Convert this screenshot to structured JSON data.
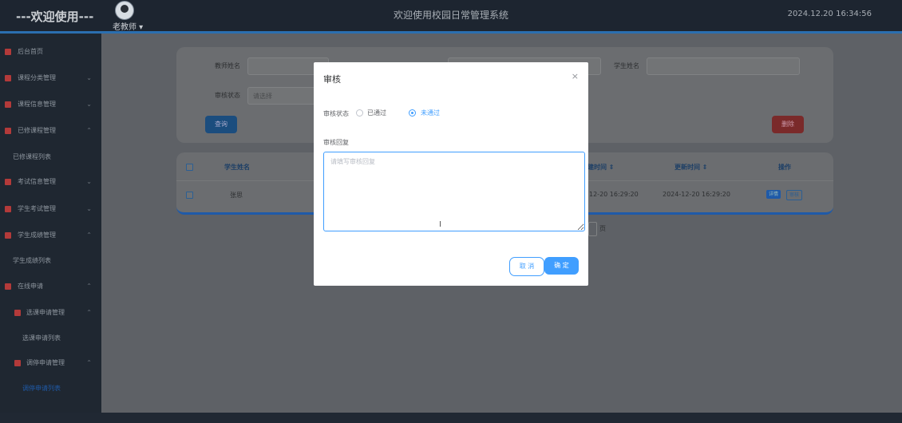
{
  "header": {
    "brand": "---欢迎使用---",
    "user": "老教师 ▾",
    "system_title": "欢迎使用校园日常管理系统",
    "datetime": "2024.12.20 16:34:56"
  },
  "sidebar": {
    "items": [
      {
        "label": "后台首页",
        "arrow": ""
      },
      {
        "label": "课程分类管理",
        "arrow": "⌄"
      },
      {
        "label": "课程信息管理",
        "arrow": "⌄"
      },
      {
        "label": "已修课程管理",
        "arrow": "⌃"
      },
      {
        "label": "已修课程列表",
        "arrow": ""
      },
      {
        "label": "考试信息管理",
        "arrow": "⌄"
      },
      {
        "label": "学生考试管理",
        "arrow": "⌄"
      },
      {
        "label": "学生成绩管理",
        "arrow": "⌃"
      },
      {
        "label": "学生成绩列表",
        "arrow": ""
      },
      {
        "label": "在线申请",
        "arrow": "⌃"
      },
      {
        "label": "选课申请管理",
        "arrow": "⌃"
      },
      {
        "label": "选课申请列表",
        "arrow": ""
      },
      {
        "label": "调停申请管理",
        "arrow": "⌃"
      },
      {
        "label": "调停申请列表",
        "arrow": ""
      }
    ]
  },
  "search": {
    "course_label": "教师姓名",
    "student_label": "学生姓名",
    "status_label": "审核状态",
    "status_placeholder": "请选择",
    "search_btn": "查询",
    "delete_btn": "删除"
  },
  "table": {
    "headers": [
      "学生姓名",
      "建时间 ⇕",
      "更新时间 ⇕",
      "操作"
    ],
    "row": {
      "student": "张思",
      "created": "12-20 16:29:20",
      "updated": "2024-12-20 16:29:20",
      "detail": "详情",
      "review": "审核"
    },
    "page_suffix": "页"
  },
  "modal": {
    "title": "审核",
    "close": "×",
    "status_label": "审核状态",
    "opt_pass": "已通过",
    "opt_fail": "未通过",
    "reply_label": "审核回复",
    "reply_placeholder": "请填写审核回复",
    "cancel": "取 消",
    "ok": "确 定"
  }
}
